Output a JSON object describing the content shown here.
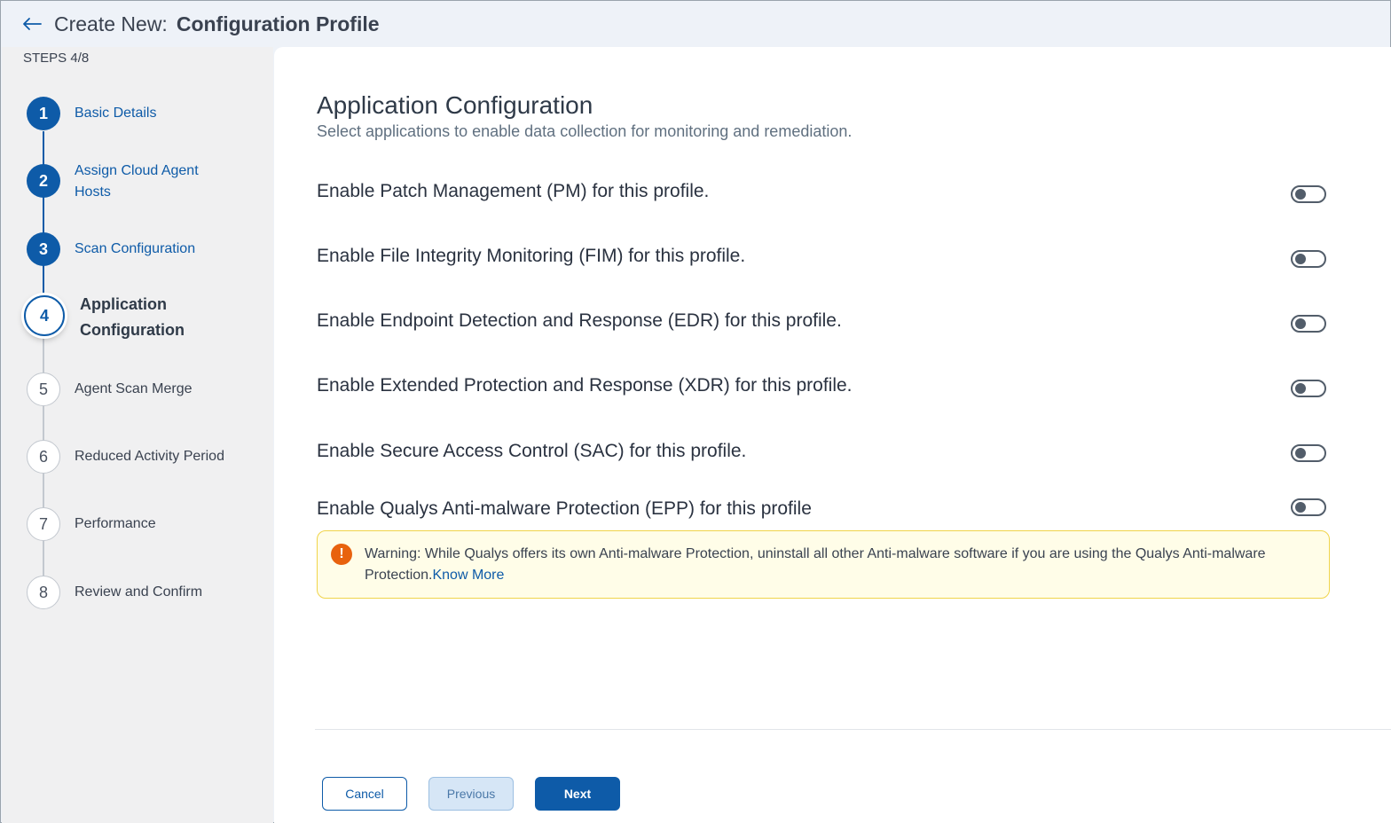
{
  "header": {
    "title_prefix": "Create New:",
    "title_main": "Configuration Profile",
    "back_icon": "arrow-left-icon"
  },
  "sidebar": {
    "steps_label": "STEPS 4/8",
    "steps": [
      {
        "number": "1",
        "label": "Basic Details",
        "status": "done"
      },
      {
        "number": "2",
        "label": "Assign Cloud Agent Hosts",
        "status": "done"
      },
      {
        "number": "3",
        "label": "Scan Configuration",
        "status": "done"
      },
      {
        "number": "4",
        "label": "Application Configuration",
        "status": "current"
      },
      {
        "number": "5",
        "label": "Agent Scan Merge",
        "status": "future"
      },
      {
        "number": "6",
        "label": "Reduced Activity Period",
        "status": "future"
      },
      {
        "number": "7",
        "label": "Performance",
        "status": "future"
      },
      {
        "number": "8",
        "label": "Review and Confirm",
        "status": "future"
      }
    ]
  },
  "main": {
    "title": "Application Configuration",
    "subtitle": "Select applications to enable data collection for monitoring and remediation.",
    "options": [
      {
        "label": "Enable Patch Management (PM) for this profile.",
        "enabled": false
      },
      {
        "label": "Enable File Integrity Monitoring (FIM) for this profile.",
        "enabled": false
      },
      {
        "label": "Enable Endpoint Detection and Response (EDR) for this profile.",
        "enabled": false
      },
      {
        "label": "Enable Extended Protection and Response (XDR) for this profile.",
        "enabled": false
      },
      {
        "label": "Enable Secure Access Control (SAC) for this profile.",
        "enabled": false
      },
      {
        "label": "Enable Qualys Anti-malware Protection (EPP) for this profile",
        "enabled": false
      }
    ],
    "warning": {
      "icon": "exclamation-icon",
      "text": "Warning: While Qualys offers its own Anti-malware Protection, uninstall all other Anti-malware software if you are using the Qualys Anti-malware Protection.",
      "link": "Know More"
    }
  },
  "footer": {
    "cancel_label": "Cancel",
    "previous_label": "Previous",
    "next_label": "Next"
  },
  "colors": {
    "primary": "#0e5ba8",
    "warning_accent": "#e8620e",
    "warning_bg": "#fffde8"
  }
}
